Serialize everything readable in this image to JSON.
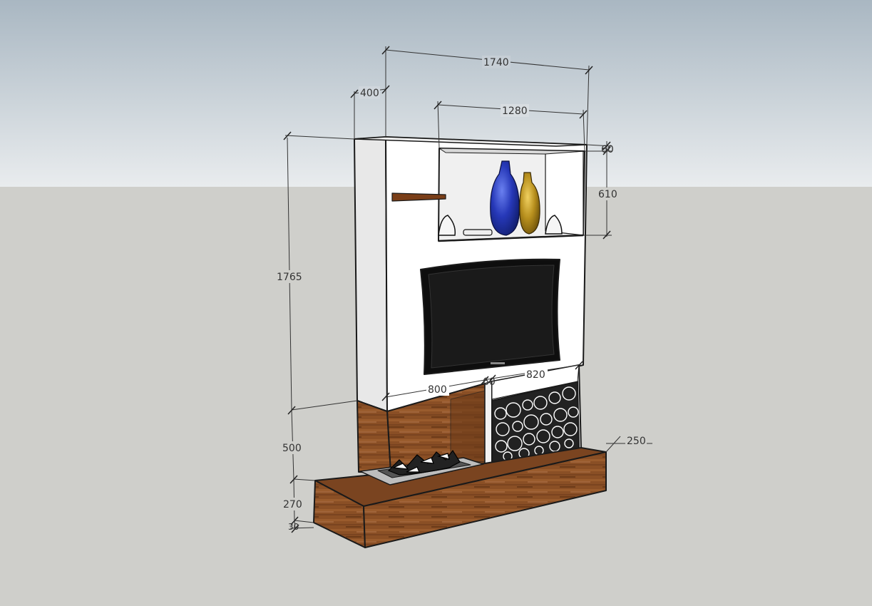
{
  "colors": {
    "sky_top": "#a9b7c2",
    "sky_bottom": "#e9ecee",
    "ground": "#cfcfcb",
    "wall_front": "#ffffff",
    "wall_side": "#e6e6e6",
    "wood": "#8a4f25",
    "wood_dark": "#6b3a18",
    "tv_screen": "#111111",
    "vase_blue": "#2638b8",
    "vase_gold": "#b8901e",
    "line": "#1a1a1a"
  },
  "dimensions": {
    "total_width": "1740",
    "side_depth": "400",
    "niche_width": "1280",
    "niche_top_offset": "60",
    "niche_height": "610",
    "total_height": "1765",
    "fireplace_width": "800",
    "divider_width": "60",
    "log_store_width": "820",
    "base_height": "500",
    "plinth_height": "270",
    "plinth_bottom": "30",
    "plinth_depth": "250"
  }
}
